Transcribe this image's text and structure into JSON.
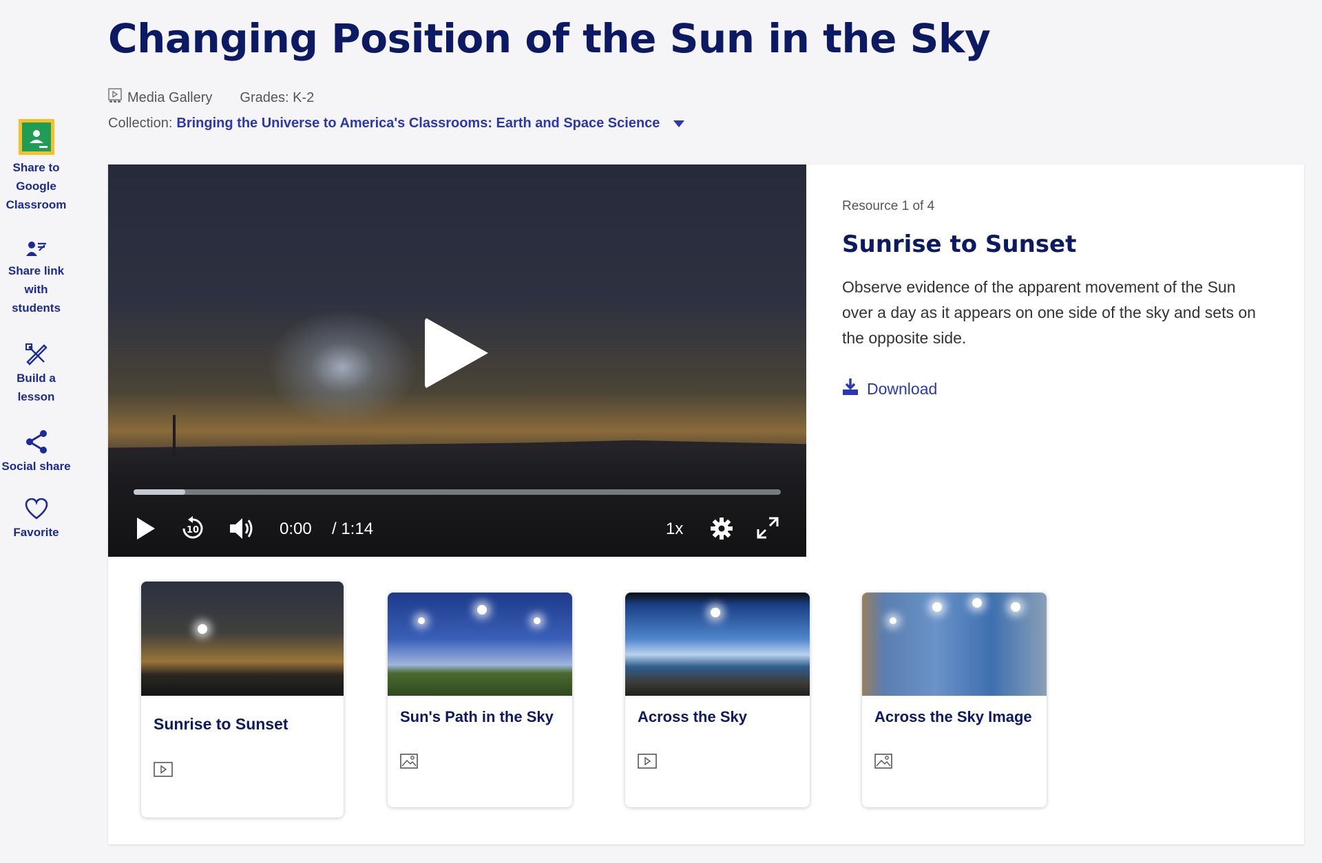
{
  "header": {
    "title": "Changing Position of the Sun in the Sky",
    "media_type": "Media Gallery",
    "grades": "Grades: K-2",
    "collection_label": "Collection:",
    "collection_name": "Bringing the Universe to America's Classrooms: Earth and Space Science"
  },
  "sidebar": {
    "items": [
      {
        "label": "Share to Google Classroom",
        "icon": "google-classroom-icon"
      },
      {
        "label": "Share link with students",
        "icon": "share-link-icon"
      },
      {
        "label": "Build a lesson",
        "icon": "build-lesson-icon"
      },
      {
        "label": "Social share",
        "icon": "share-icon"
      },
      {
        "label": "Favorite",
        "icon": "heart-icon"
      }
    ]
  },
  "player": {
    "current_time": "0:00",
    "duration": "/ 1:14",
    "speed": "1x",
    "progress_fraction": 0.08
  },
  "resource": {
    "count": "Resource 1 of 4",
    "title": "Sunrise to Sunset",
    "description": "Observe evidence of the apparent movement of the Sun over a day as it appears on one side of the sky and sets on the opposite side.",
    "download_label": "Download"
  },
  "thumbnails": [
    {
      "title": "Sunrise to Sunset",
      "type": "video-icon"
    },
    {
      "title": "Sun's Path in the Sky",
      "type": "image-icon"
    },
    {
      "title": "Across the Sky",
      "type": "video-icon"
    },
    {
      "title": "Across the Sky Image",
      "type": "image-icon"
    }
  ],
  "colors": {
    "title": "#0b1a63",
    "link": "#2a37b8",
    "background": "#f5f5f8"
  }
}
